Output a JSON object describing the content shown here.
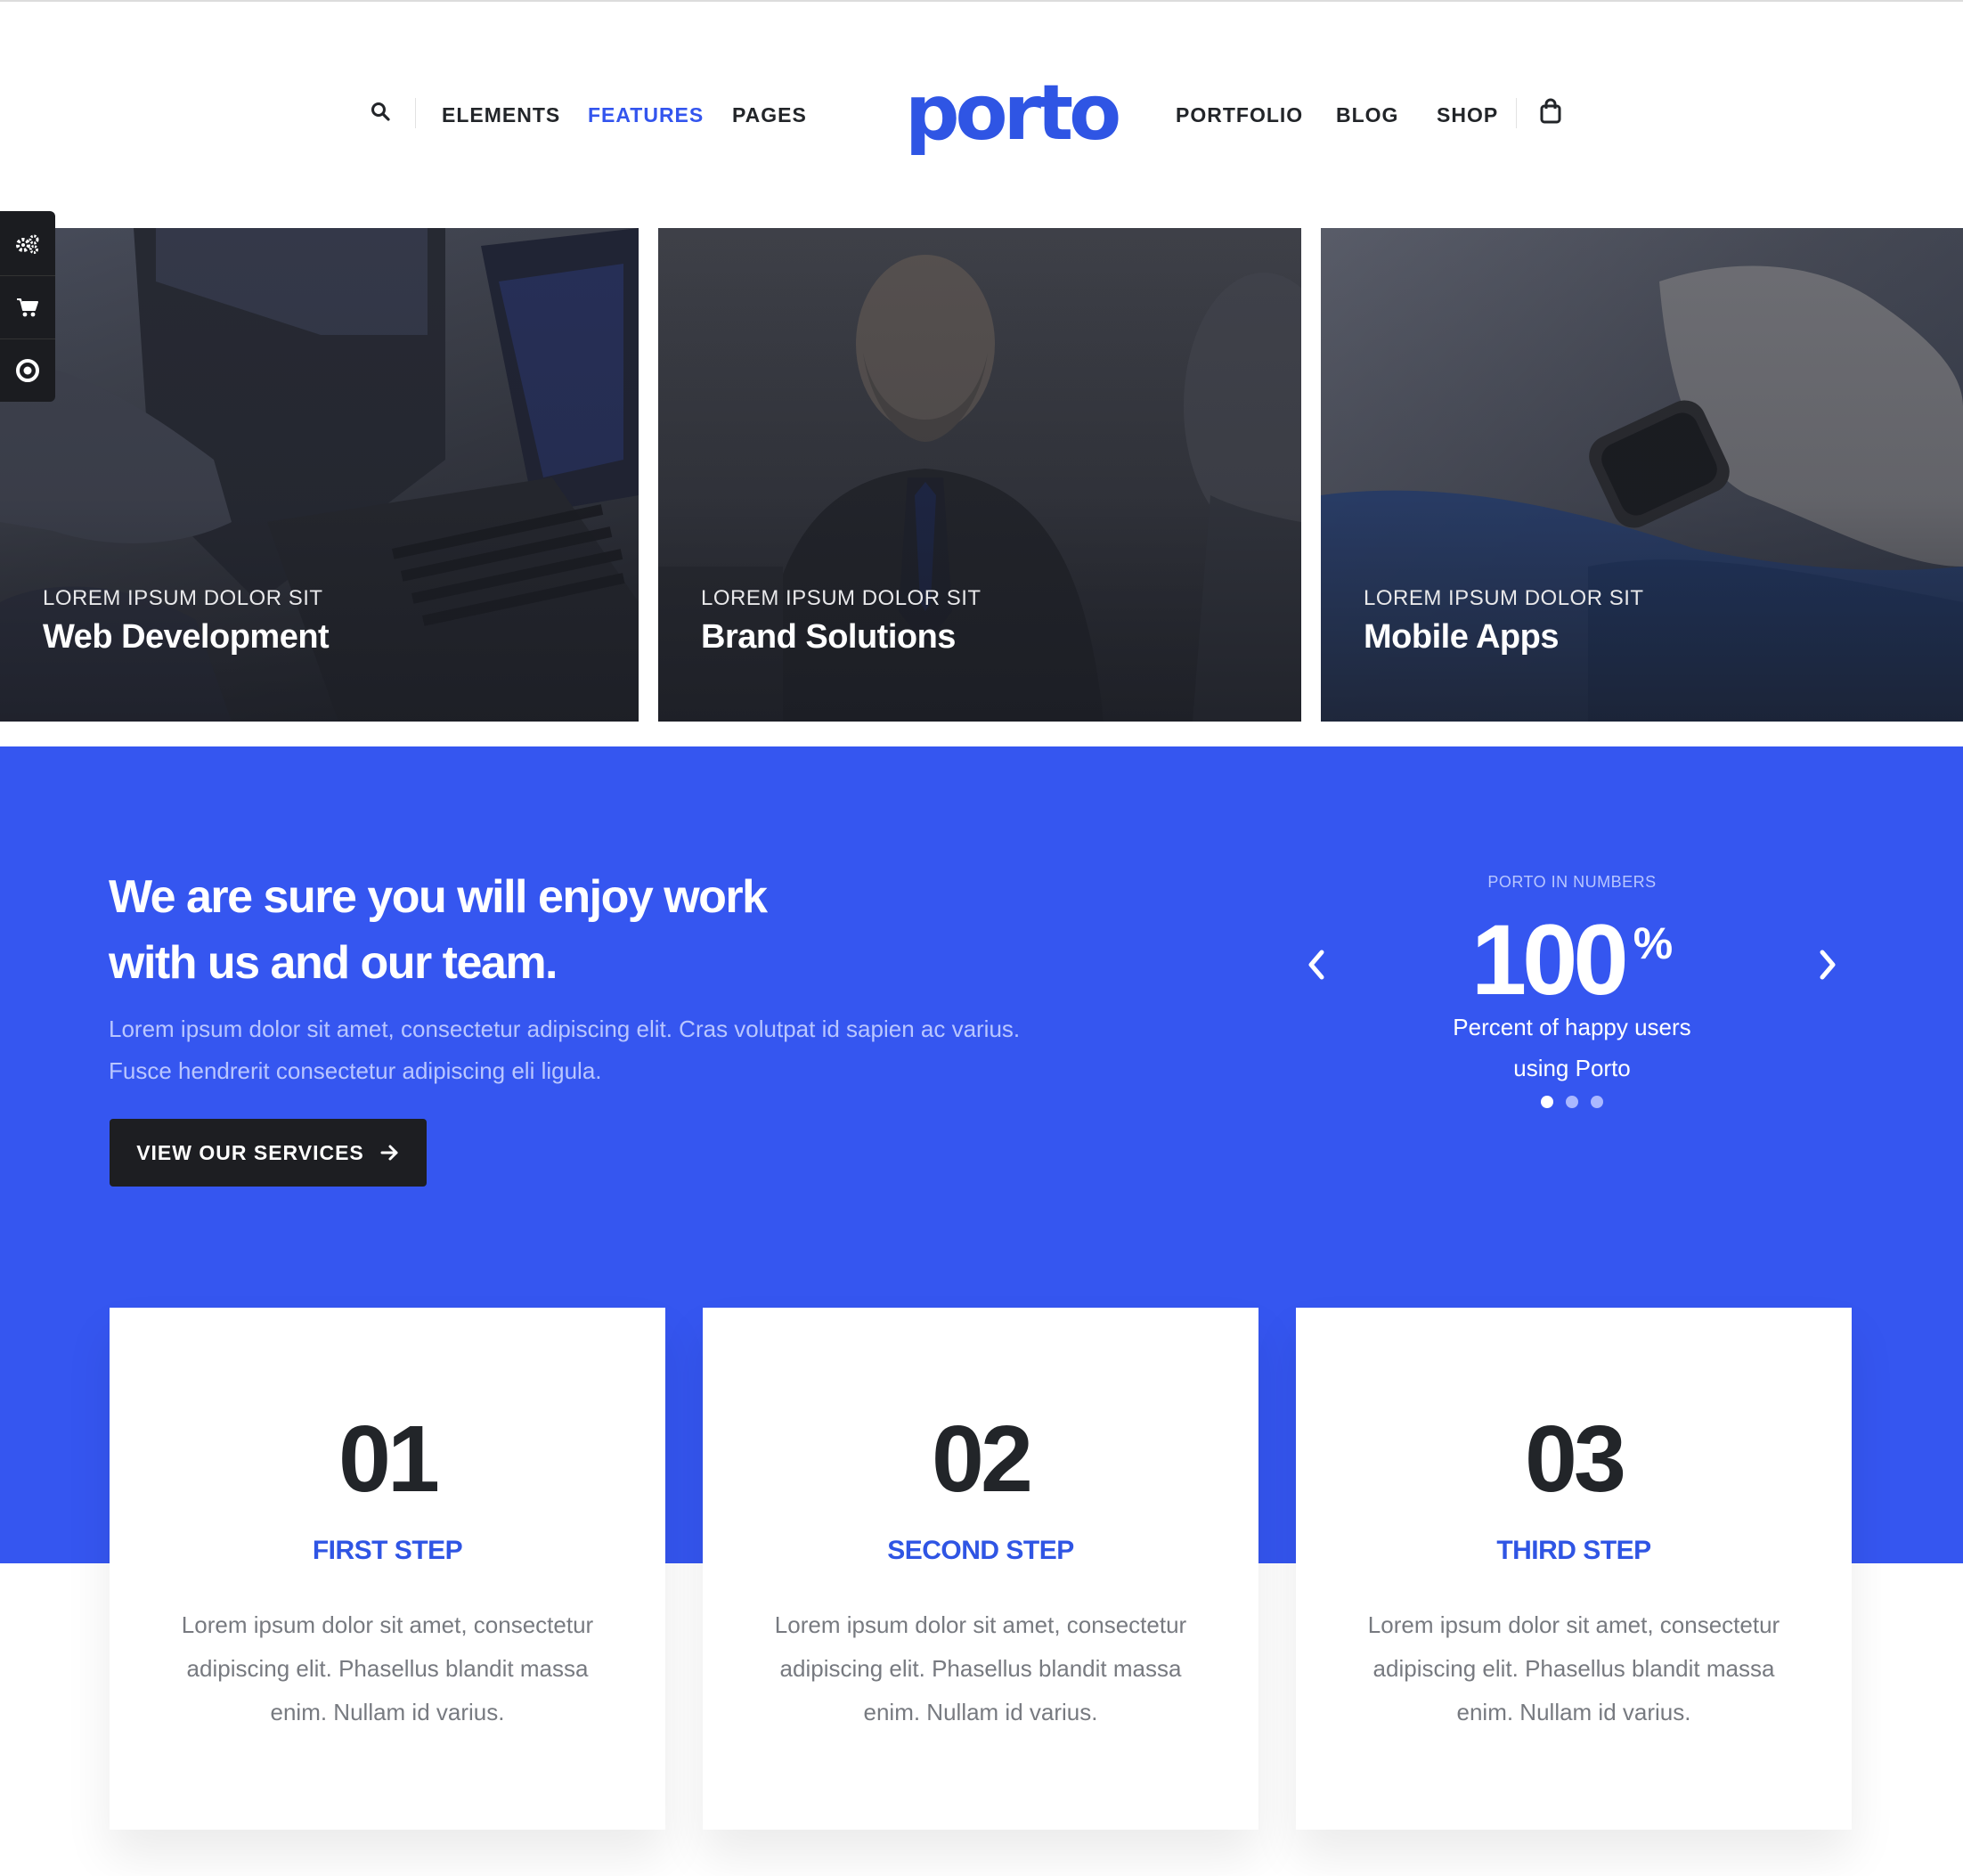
{
  "header": {
    "nav_left": [
      "ELEMENTS",
      "FEATURES",
      "PAGES"
    ],
    "nav_right": [
      "PORTFOLIO",
      "BLOG",
      "SHOP"
    ],
    "active_item": "FEATURES",
    "logo": "porto",
    "icons": [
      "search-icon",
      "shopping-bag-icon"
    ]
  },
  "side_tools": [
    "gears-icon",
    "cart-icon",
    "circle-target-icon"
  ],
  "services": [
    {
      "kicker": "LOREM IPSUM DOLOR SIT",
      "title": "Web Development"
    },
    {
      "kicker": "LOREM IPSUM DOLOR SIT",
      "title": "Brand Solutions"
    },
    {
      "kicker": "LOREM IPSUM DOLOR SIT",
      "title": "Mobile Apps"
    }
  ],
  "intro": {
    "headline_line1": "We are sure you will enjoy work",
    "headline_line2": "with us and our team.",
    "lead": "Lorem ipsum dolor sit amet, consectetur adipiscing elit. Cras volutpat id sapien ac varius. Fusce hendrerit consectetur adipiscing eli ligula.",
    "button_label": "VIEW OUR SERVICES"
  },
  "numbers": {
    "kicker": "PORTO IN NUMBERS",
    "value": "100",
    "unit": "%",
    "label_line1": "Percent of happy users",
    "label_line2": "using Porto",
    "slide_count": 3,
    "active_slide": 1
  },
  "steps": [
    {
      "num": "01",
      "label": "FIRST STEP",
      "text": "Lorem ipsum dolor sit amet, consectetur adipiscing elit. Phasellus blandit massa enim. Nullam id varius."
    },
    {
      "num": "02",
      "label": "SECOND STEP",
      "text": "Lorem ipsum dolor sit amet, consectetur adipiscing elit. Phasellus blandit massa enim. Nullam id varius."
    },
    {
      "num": "03",
      "label": "THIRD STEP",
      "text": "Lorem ipsum dolor sit amet, consectetur adipiscing elit. Phasellus blandit massa enim. Nullam id varius."
    }
  ],
  "colors": {
    "accent": "#3556f0",
    "logo": "#2f55e4",
    "dark": "#1d1e22",
    "text_muted": "#777a80"
  }
}
